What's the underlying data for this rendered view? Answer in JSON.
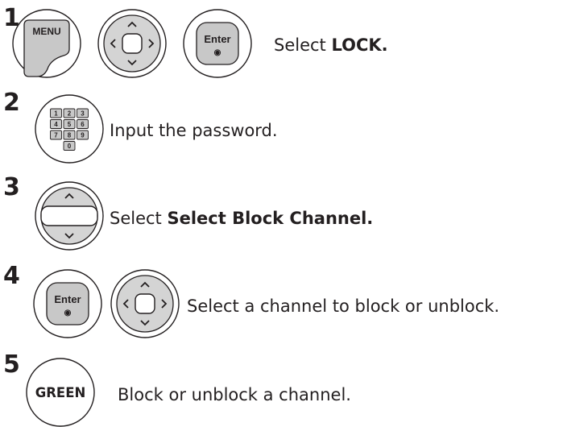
{
  "steps": [
    {
      "number": "1",
      "keys": [
        "MENU",
        "navigation-pad",
        "Enter"
      ],
      "text_before": "Select ",
      "text_bold": "LOCK.",
      "text_after": ""
    },
    {
      "number": "2",
      "keys": [
        "number-keypad"
      ],
      "keypad_digits": [
        "1",
        "2",
        "3",
        "4",
        "5",
        "6",
        "7",
        "8",
        "9",
        "0"
      ],
      "text_before": "Input the password.",
      "text_bold": "",
      "text_after": ""
    },
    {
      "number": "3",
      "keys": [
        "up-down-pad"
      ],
      "text_before": "Select ",
      "text_bold": "Select Block Channel.",
      "text_after": ""
    },
    {
      "number": "4",
      "keys": [
        "Enter",
        "navigation-pad"
      ],
      "text_before": "Select a channel to block or unblock.",
      "text_bold": "",
      "text_after": ""
    },
    {
      "number": "5",
      "keys": [
        "GREEN"
      ],
      "text_before": "Block or unblock a channel.",
      "text_bold": "",
      "text_after": ""
    }
  ],
  "key_labels": {
    "menu": "MENU",
    "enter": "Enter",
    "enter_dot": "◉",
    "green": "GREEN"
  },
  "colors": {
    "ink": "#231f20",
    "key_fill": "#c8c8c8",
    "pad_fill": "#d4d4d4"
  }
}
